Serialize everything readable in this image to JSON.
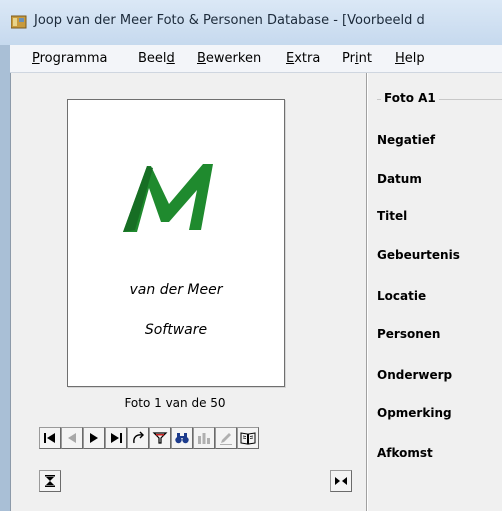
{
  "window": {
    "title": "Joop van der Meer Foto & Personen Database - [Voorbeeld d"
  },
  "menu": {
    "items": [
      {
        "pre": "",
        "u": "P",
        "post": "rogramma"
      },
      {
        "pre": "Beel",
        "u": "d",
        "post": ""
      },
      {
        "pre": "",
        "u": "B",
        "post": "ewerken"
      },
      {
        "pre": "",
        "u": "E",
        "post": "xtra"
      },
      {
        "pre": "Pr",
        "u": "i",
        "post": "nt"
      },
      {
        "pre": "",
        "u": "H",
        "post": "elp"
      }
    ]
  },
  "preview": {
    "logo_letter": "M",
    "logo_color": "#1f8a2e",
    "line1": "van der Meer",
    "line2": "Software"
  },
  "counter": "Foto 1 van de 50",
  "navigation": {
    "buttons": [
      "first-icon",
      "previous-icon",
      "next-icon",
      "last-icon",
      "rotate-icon",
      "filter-icon",
      "binoculars-icon",
      "chart-icon",
      "edit-icon",
      "book-icon"
    ],
    "disabled": [
      "previous-icon",
      "chart-icon",
      "edit-icon"
    ]
  },
  "bottom_buttons": [
    "expand-vertical-icon",
    "expand-horizontal-icon"
  ],
  "details": {
    "group_title": "Foto A1",
    "fields": [
      "Negatief",
      "Datum",
      "Titel",
      "Gebeurtenis",
      "Locatie",
      "Personen",
      "Onderwerp",
      "Opmerking",
      "Afkomst"
    ]
  }
}
